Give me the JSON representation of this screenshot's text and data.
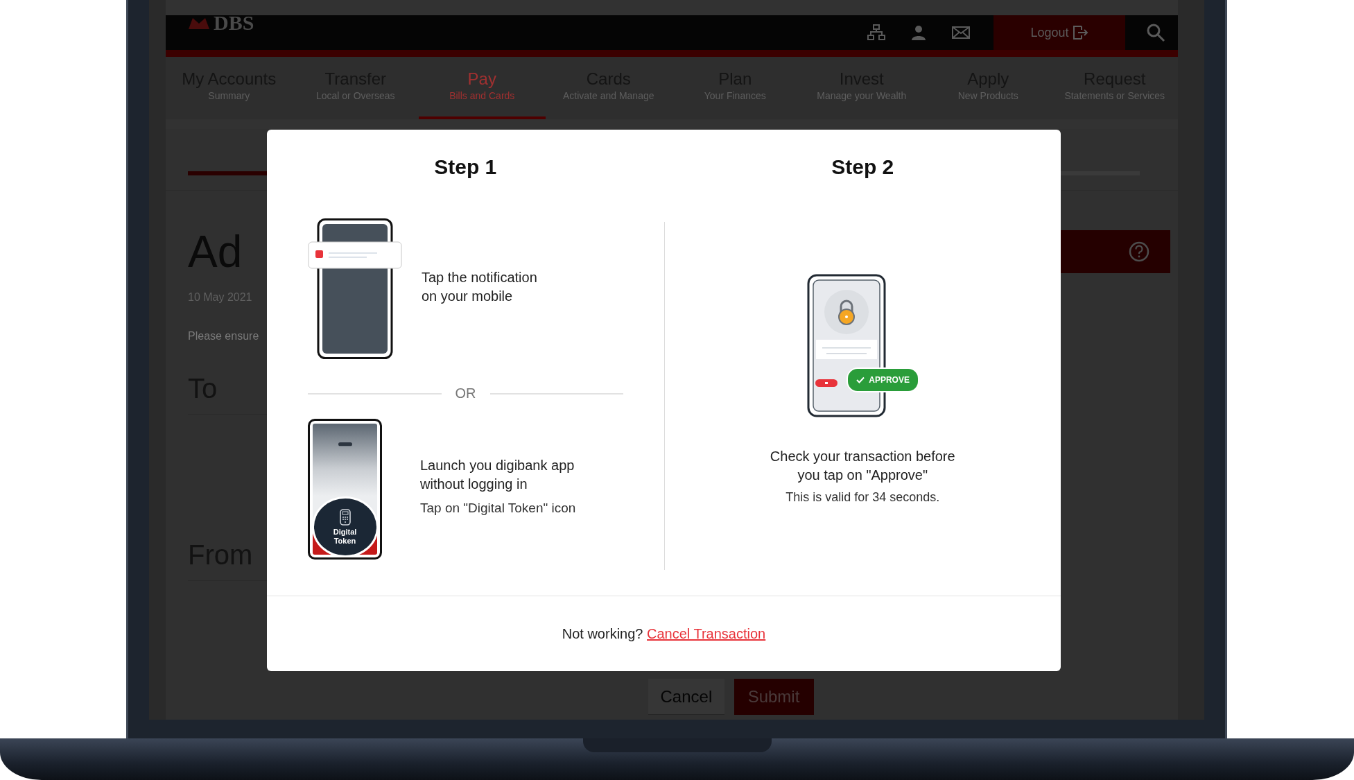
{
  "header": {
    "logo": "DBS",
    "logout": "Logout"
  },
  "nav": [
    {
      "title": "My Accounts",
      "subtitle": "Summary",
      "selected": false
    },
    {
      "title": "Transfer",
      "subtitle": "Local or Overseas",
      "selected": false
    },
    {
      "title": "Pay",
      "subtitle": "Bills and Cards",
      "selected": true
    },
    {
      "title": "Cards",
      "subtitle": "Activate and Manage",
      "selected": false
    },
    {
      "title": "Plan",
      "subtitle": "Your Finances",
      "selected": false
    },
    {
      "title": "Invest",
      "subtitle": "Manage your Wealth",
      "selected": false
    },
    {
      "title": "Apply",
      "subtitle": "New Products",
      "selected": false
    },
    {
      "title": "Request",
      "subtitle": "Statements or Services",
      "selected": false
    }
  ],
  "page": {
    "title": "Ad",
    "date": "10 May 2021",
    "note": "Please ensure",
    "sections": [
      "To",
      "From"
    ]
  },
  "actions": [
    {
      "label": "Cancel",
      "kind": "secondary"
    },
    {
      "label": "Submit",
      "kind": "primary"
    }
  ],
  "modal": {
    "steps": [
      {
        "title": "Step 1",
        "divider": "OR",
        "options": [
          {
            "kind": "notification",
            "text": "Tap the notification\non your mobile"
          },
          {
            "kind": "token",
            "text": "Launch you digibank app\nwithout logging in",
            "hint": "Tap on \"Digital Token\" icon",
            "badge": "Digital\nToken"
          }
        ]
      },
      {
        "title": "Step 2",
        "options": [
          {
            "kind": "approve",
            "badge": "APPROVE",
            "text": "Check your transaction before\nyou tap on \"Approve\"",
            "hint": "This is valid for 34 seconds."
          }
        ]
      }
    ],
    "footer": {
      "text": "Not working?",
      "link": "Cancel Transaction"
    }
  }
}
